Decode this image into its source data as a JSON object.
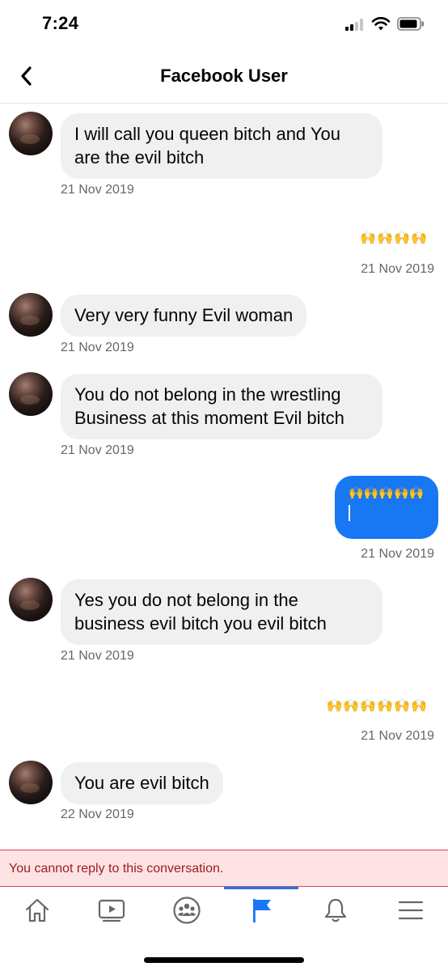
{
  "status_bar": {
    "time": "7:24"
  },
  "header": {
    "title": "Facebook User"
  },
  "messages": [
    {
      "direction": "incoming",
      "text": "I will call you queen bitch and You are the evil bitch",
      "date": "21 Nov 2019"
    },
    {
      "direction": "outgoing",
      "type": "emoji",
      "text": "🙌🙌🙌🙌",
      "date": "21 Nov 2019"
    },
    {
      "direction": "incoming",
      "text": "Very very funny Evil woman",
      "date": "21 Nov 2019"
    },
    {
      "direction": "incoming",
      "text": "You do not belong in the wrestling Business at this moment Evil bitch",
      "date": "21 Nov 2019"
    },
    {
      "direction": "outgoing",
      "type": "bubble",
      "text": "🙌🙌🙌🙌🙌",
      "date": "21 Nov 2019"
    },
    {
      "direction": "incoming",
      "text": "Yes you do not belong in the business evil bitch you evil bitch",
      "date": "21 Nov 2019"
    },
    {
      "direction": "outgoing",
      "type": "emoji",
      "text": "🙌🙌🙌🙌🙌🙌",
      "date": "21 Nov 2019"
    },
    {
      "direction": "incoming",
      "text": "You are evil bitch",
      "date": "22 Nov 2019"
    }
  ],
  "banner": {
    "text": "You cannot reply to this conversation."
  },
  "tabbar": {
    "items": [
      {
        "icon": "home-icon"
      },
      {
        "icon": "video-icon"
      },
      {
        "icon": "groups-icon"
      },
      {
        "icon": "pages-flag-icon",
        "active": true
      },
      {
        "icon": "notifications-bell-icon"
      },
      {
        "icon": "menu-icon"
      }
    ]
  },
  "colors": {
    "accent": "#1877f2",
    "incoming_bubble": "#f0f0f0",
    "banner_bg": "#fde3e3",
    "banner_text": "#9c1b1f"
  }
}
